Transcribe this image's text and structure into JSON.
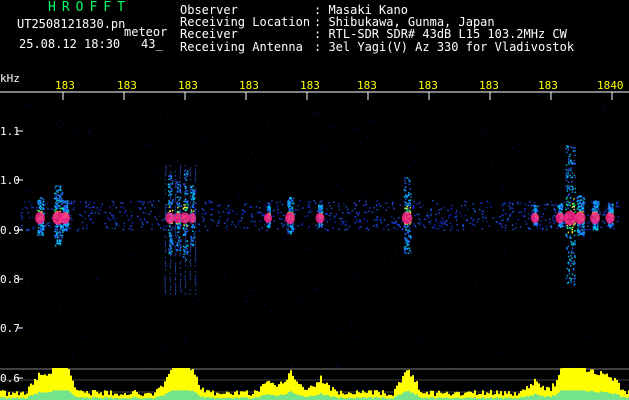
{
  "header": {
    "title": "HROFFT",
    "filename": "UT2508121830.pn",
    "file_suffix": "meteor",
    "datetime": "25.08.12 18:30",
    "count": "43_"
  },
  "info": [
    {
      "label": "Observer",
      "value": ": Masaki Kano"
    },
    {
      "label": "Receiving Location",
      "value": ": Shibukawa, Gunma, Japan"
    },
    {
      "label": "Receiver",
      "value": ": RTL-SDR SDR# 43dB L15 103.2MHz CW"
    },
    {
      "label": "Receiving Antenna",
      "value": ": 3el Yagi(V) Az 330 for Vladivostok"
    }
  ],
  "axis": {
    "unit": "kHz",
    "y_ticks": [
      "1.1",
      "1.0",
      "0.9",
      "0.8",
      "0.7",
      "0.6"
    ],
    "x_ticks": [
      "183",
      "183",
      "183",
      "183",
      "183",
      "183",
      "183",
      "183",
      "183",
      "1840"
    ]
  },
  "colors": {
    "text": "#ffffff",
    "tick_labels": "#ffff00",
    "title": "#00ff66",
    "background": "#000000",
    "histogram": "#ffff00"
  }
}
